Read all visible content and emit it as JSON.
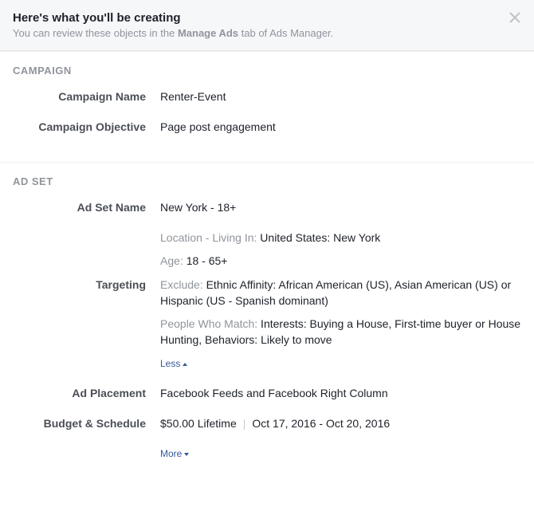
{
  "header": {
    "title": "Here's what you'll be creating",
    "subtitle_pre": "You can review these objects in the ",
    "subtitle_bold": "Manage Ads",
    "subtitle_post": " tab of Ads Manager."
  },
  "campaign": {
    "section_title": "CAMPAIGN",
    "name_label": "Campaign Name",
    "name_value": "Renter-Event",
    "objective_label": "Campaign Objective",
    "objective_value": "Page post engagement"
  },
  "adset": {
    "section_title": "AD SET",
    "name_label": "Ad Set Name",
    "name_value": "New York - 18+",
    "targeting_label": "Targeting",
    "targeting": {
      "location_key": "Location - Living In:",
      "location_val": " United States: New York",
      "age_key": "Age:",
      "age_val": " 18 - 65+",
      "exclude_key": "Exclude:",
      "exclude_val": " Ethnic Affinity: African American (US), Asian American (US) or Hispanic (US - Spanish dominant)",
      "match_key": "People Who Match:",
      "match_val": " Interests: Buying a House, First-time buyer or House Hunting, Behaviors: Likely to move"
    },
    "less_label": "Less",
    "placement_label": "Ad Placement",
    "placement_value": "Facebook Feeds and Facebook Right Column",
    "budget_label": "Budget & Schedule",
    "budget_value": "$50.00 Lifetime",
    "schedule_value": "Oct 17, 2016 - Oct 20, 2016",
    "more_label": "More"
  }
}
